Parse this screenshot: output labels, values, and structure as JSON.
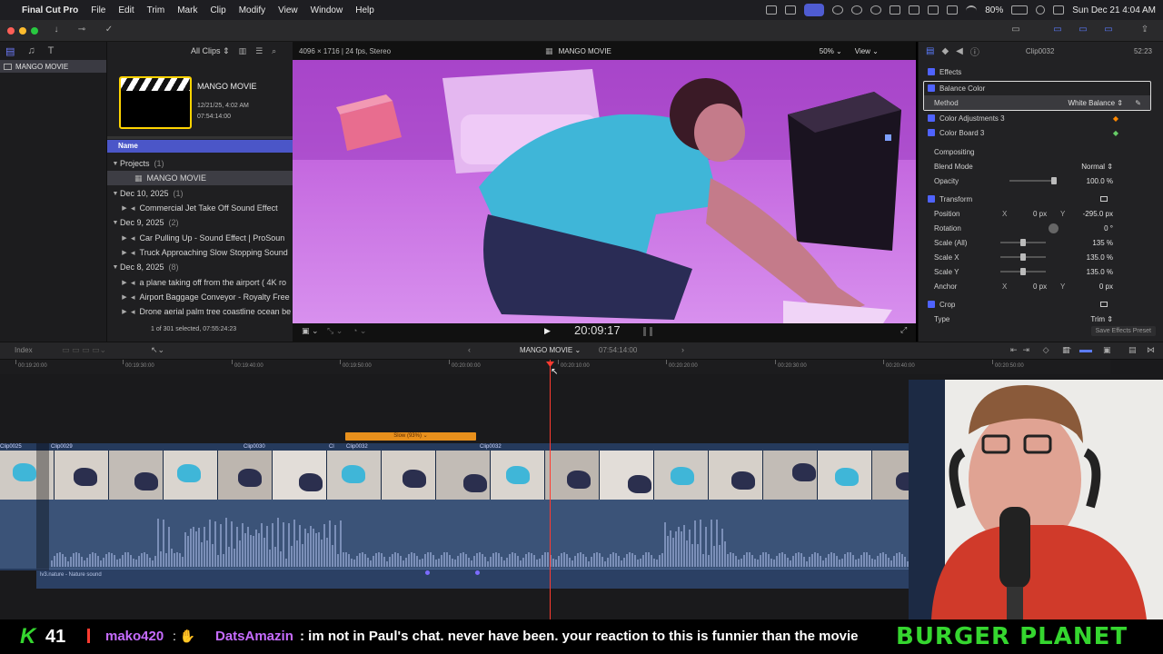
{
  "menubar": {
    "app": "Final Cut Pro",
    "items": [
      "File",
      "Edit",
      "Trim",
      "Mark",
      "Clip",
      "Modify",
      "View",
      "Window",
      "Help"
    ],
    "battery": "80%",
    "datetime": "Sun Dec 21  4:04 AM"
  },
  "browser": {
    "filter": "All Clips",
    "library_name": "MANGO MOVIE",
    "project_title": "MANGO MOVIE",
    "project_date": "12/21/25, 4:02 AM",
    "project_duration": "07:54:14:00",
    "column_name": "Name",
    "tree": [
      {
        "label": "Projects",
        "count": "(1)",
        "kind": "group"
      },
      {
        "label": "MANGO MOVIE",
        "count": "",
        "kind": "project"
      },
      {
        "label": "Dec 10, 2025",
        "count": "(1)",
        "kind": "group"
      },
      {
        "label": "Commercial Jet Take Off Sound Effect",
        "count": "",
        "kind": "clip"
      },
      {
        "label": "Dec 9, 2025",
        "count": "(2)",
        "kind": "group"
      },
      {
        "label": "Car Pulling Up - Sound Effect  |  ProSoun",
        "count": "",
        "kind": "clip"
      },
      {
        "label": "Truck Approaching Slow Stopping Sound",
        "count": "",
        "kind": "clip"
      },
      {
        "label": "Dec 8, 2025",
        "count": "(8)",
        "kind": "group"
      },
      {
        "label": "a plane taking off from the airport ( 4K ro",
        "count": "",
        "kind": "clip"
      },
      {
        "label": "Airport Baggage Conveyor - Royalty Free",
        "count": "",
        "kind": "clip"
      },
      {
        "label": "Drone aerial palm tree coastline ocean be",
        "count": "",
        "kind": "clip"
      }
    ],
    "selection_status": "1 of 301 selected, 07:55:24:23"
  },
  "viewer": {
    "format": "4096 × 1716 | 24 fps, Stereo",
    "title": "MANGO MOVIE",
    "zoom": "50%",
    "view_label": "View",
    "timecode": "20:09:17"
  },
  "inspector": {
    "clip_name": "Clip0032",
    "duration": "52:23",
    "rows": {
      "effects": "Effects",
      "balance_color": "Balance Color",
      "method": "Method",
      "method_value": "White Balance",
      "color_adj": "Color Adjustments 3",
      "color_board": "Color Board 3",
      "compositing": "Compositing",
      "blend_mode": "Blend Mode",
      "blend_value": "Normal",
      "opacity": "Opacity",
      "opacity_value": "100.0 %",
      "transform": "Transform",
      "position": "Position",
      "pos_x_label": "X",
      "pos_x": "0 px",
      "pos_y_label": "Y",
      "pos_y": "-295.0 px",
      "rotation": "Rotation",
      "rotation_value": "0 °",
      "scale_all": "Scale (All)",
      "scale_all_value": "135 %",
      "scale_x": "Scale X",
      "scale_x_value": "135.0 %",
      "scale_y": "Scale Y",
      "scale_y_value": "135.0 %",
      "anchor": "Anchor",
      "anchor_x": "0 px",
      "anchor_y": "0 px",
      "crop": "Crop",
      "type": "Type",
      "type_value": "Trim",
      "save_preset": "Save Effects Preset"
    }
  },
  "timeline": {
    "index": "Index",
    "project": "MANGO MOVIE",
    "duration": "07:54:14:00",
    "ruler": [
      "00:19:20:00",
      "00:19:30:00",
      "00:19:40:00",
      "00:19:50:00",
      "00:20:00:00",
      "00:20:10:00",
      "00:20:20:00",
      "00:20:30:00",
      "00:20:40:00",
      "00:20:50:00"
    ],
    "retime": "Slow (93%)",
    "clips": [
      "Clip0025",
      "Clip0029",
      "Clip0030",
      "Cl",
      "Clip0032",
      "Clip0032"
    ],
    "audio_clip": "lv3.nature - Nature sound"
  },
  "stream": {
    "k_count": "41",
    "user1": "mako420",
    "user2": "DatsAmazin",
    "message": ": im not in Paul's chat. never have been. your reaction to this is funnier than the movie",
    "brand": "BURGER PLANET"
  },
  "colors": {
    "accent": "#4f63ff",
    "playhead": "#ff3b30",
    "retime": "#e8901c",
    "stream_green": "#35d62f",
    "stream_purple": "#c66cff"
  }
}
